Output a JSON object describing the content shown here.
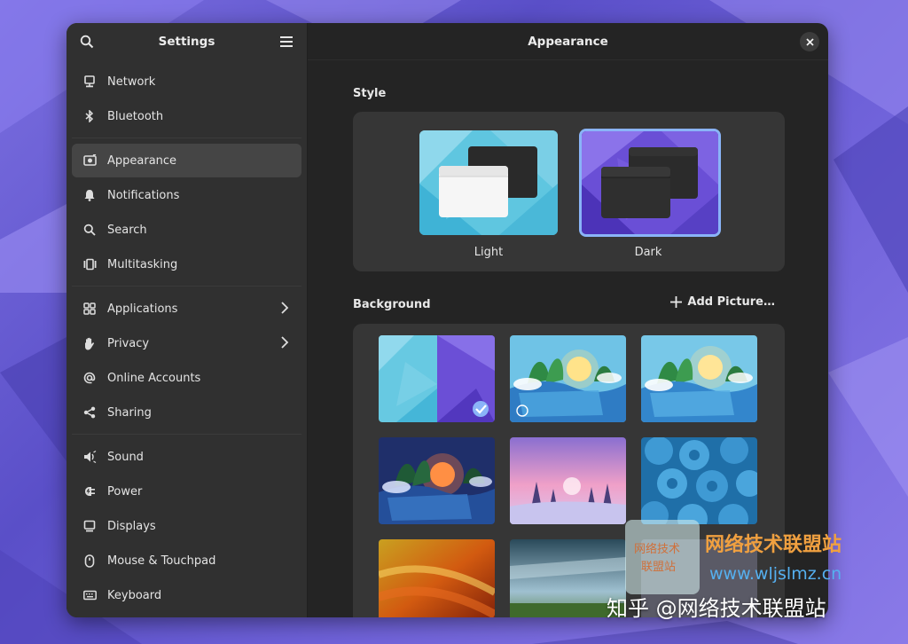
{
  "window": {
    "title": "Settings",
    "page_title": "Appearance"
  },
  "sidebar": {
    "items": [
      {
        "label": "Network",
        "icon": "network-icon"
      },
      {
        "label": "Bluetooth",
        "icon": "bluetooth-icon"
      },
      {
        "label": "Appearance",
        "icon": "appearance-icon",
        "active": true
      },
      {
        "label": "Notifications",
        "icon": "bell-icon"
      },
      {
        "label": "Search",
        "icon": "search-icon"
      },
      {
        "label": "Multitasking",
        "icon": "multitasking-icon"
      },
      {
        "label": "Applications",
        "icon": "grid-icon",
        "has_submenu": true
      },
      {
        "label": "Privacy",
        "icon": "hand-icon",
        "has_submenu": true
      },
      {
        "label": "Online Accounts",
        "icon": "at-icon"
      },
      {
        "label": "Sharing",
        "icon": "share-icon"
      },
      {
        "label": "Sound",
        "icon": "speaker-icon"
      },
      {
        "label": "Power",
        "icon": "power-icon"
      },
      {
        "label": "Displays",
        "icon": "display-icon"
      },
      {
        "label": "Mouse & Touchpad",
        "icon": "mouse-icon"
      },
      {
        "label": "Keyboard",
        "icon": "keyboard-icon"
      }
    ]
  },
  "style_section": {
    "label": "Style",
    "options": [
      {
        "label": "Light",
        "selected": false
      },
      {
        "label": "Dark",
        "selected": true
      }
    ]
  },
  "background_section": {
    "label": "Background",
    "add_button": "Add Picture…",
    "thumbnails": [
      {
        "name": "triangles",
        "selected": true
      },
      {
        "name": "landscape-day",
        "radio": true
      },
      {
        "name": "landscape-day-alt"
      },
      {
        "name": "landscape-night"
      },
      {
        "name": "snowy-forest"
      },
      {
        "name": "blue-pattern"
      },
      {
        "name": "macro-texture"
      },
      {
        "name": "sky-field"
      }
    ]
  },
  "watermark": {
    "logo_line1": "网络技术",
    "logo_line2": "联盟站",
    "site_name": "网络技术联盟站",
    "url": "www.wljslmz.cn",
    "zhihu": "知乎 @网络技术联盟站"
  },
  "colors": {
    "accent": "#8ab4f8",
    "window_bg": "#242424",
    "sidebar_bg": "#303030"
  }
}
